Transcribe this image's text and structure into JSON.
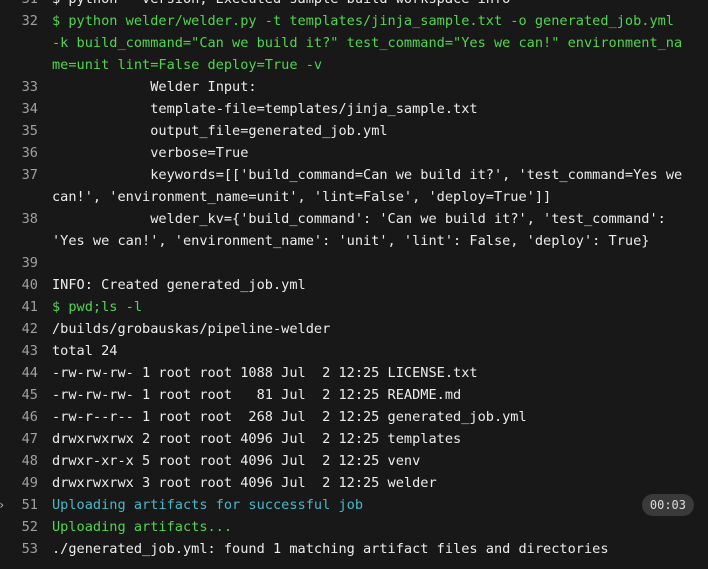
{
  "lines": [
    {
      "n": "31",
      "t": "$ python --version; Executed sample build workspace info"
    },
    {
      "n": "32",
      "t": "$ python welder/welder.py -t templates/jinja_sample.txt -o generated_job.yml -k build_command=\"Can we build it?\" test_command=\"Yes we can!\" environment_name=unit lint=False deploy=True -v"
    },
    {
      "n": "33",
      "t": "            Welder Input:"
    },
    {
      "n": "34",
      "t": "            template-file=templates/jinja_sample.txt"
    },
    {
      "n": "35",
      "t": "            output_file=generated_job.yml"
    },
    {
      "n": "36",
      "t": "            verbose=True"
    },
    {
      "n": "37",
      "t": "            keywords=[['build_command=Can we build it?', 'test_command=Yes we can!', 'environment_name=unit', 'lint=False', 'deploy=True']]"
    },
    {
      "n": "38",
      "t": "            welder_kv={'build_command': 'Can we build it?', 'test_command': 'Yes we can!', 'environment_name': 'unit', 'lint': False, 'deploy': True}"
    },
    {
      "n": "39",
      "t": ""
    },
    {
      "n": "40",
      "t": "INFO: Created generated_job.yml"
    },
    {
      "n": "41",
      "t": "$ pwd;ls -l"
    },
    {
      "n": "42",
      "t": "/builds/grobauskas/pipeline-welder"
    },
    {
      "n": "43",
      "t": "total 24"
    },
    {
      "n": "44",
      "t": "-rw-rw-rw- 1 root root 1088 Jul  2 12:25 LICENSE.txt"
    },
    {
      "n": "45",
      "t": "-rw-rw-rw- 1 root root   81 Jul  2 12:25 README.md"
    },
    {
      "n": "46",
      "t": "-rw-r--r-- 1 root root  268 Jul  2 12:25 generated_job.yml"
    },
    {
      "n": "47",
      "t": "drwxrwxrwx 2 root root 4096 Jul  2 12:25 templates"
    },
    {
      "n": "48",
      "t": "drwxr-xr-x 5 root root 4096 Jul  2 12:25 venv"
    },
    {
      "n": "49",
      "t": "drwxrwxrwx 3 root root 4096 Jul  2 12:25 welder"
    },
    {
      "n": "51",
      "t": "Uploading artifacts for successful job"
    },
    {
      "n": "52",
      "t": "Uploading artifacts..."
    },
    {
      "n": "53",
      "t": "./generated_job.yml: found 1 matching artifact files and directories"
    }
  ],
  "section_timer": "00:03",
  "colors": {
    "background": "#181818",
    "command": "#4fd64f",
    "section": "#47b8c8",
    "line_number": "#a0a0a0",
    "text": "#ececec"
  }
}
